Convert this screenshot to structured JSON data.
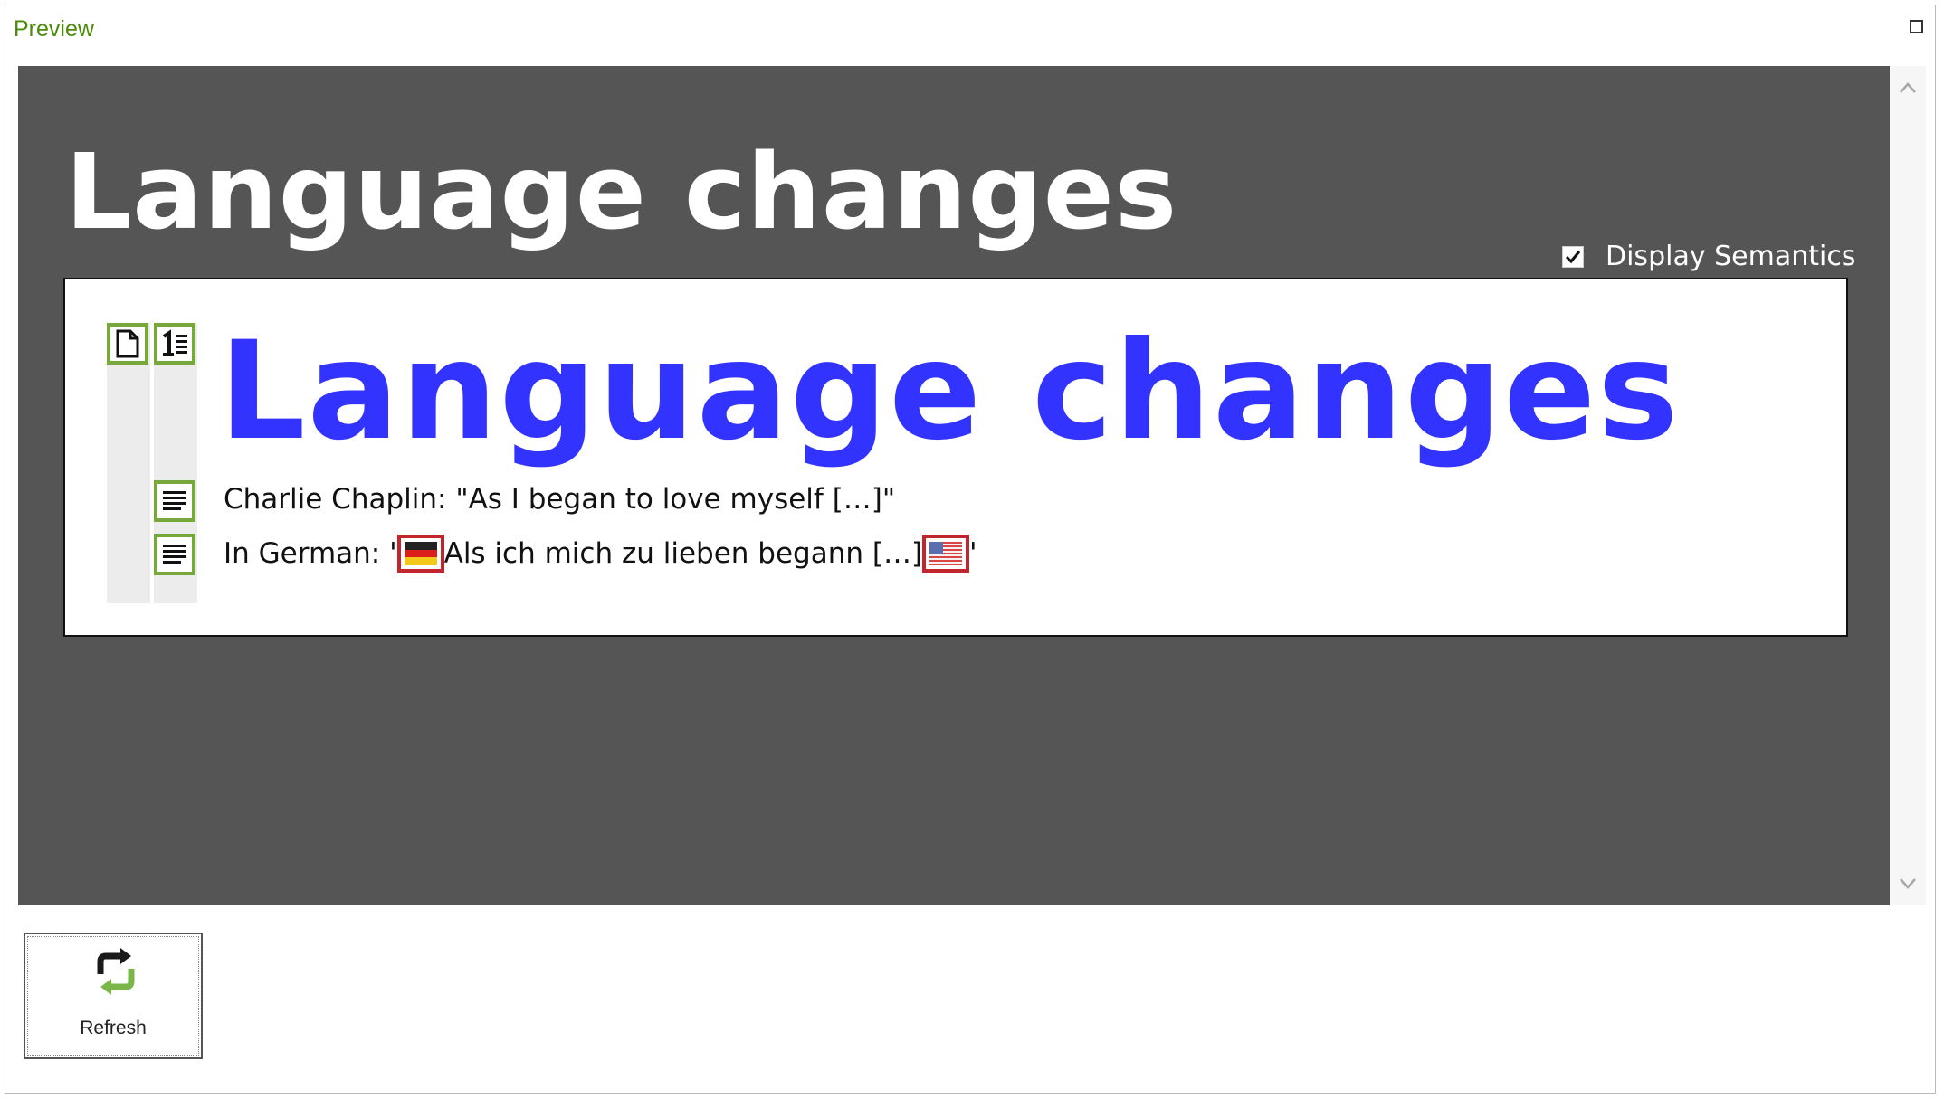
{
  "window": {
    "title": "Preview"
  },
  "preview": {
    "heading": "Language changes",
    "display_semantics": {
      "label": "Display Semantics",
      "checked": true
    }
  },
  "document": {
    "heading": "Language changes",
    "paragraph_1": "Charlie Chaplin: \"As I began to love myself […]\"",
    "paragraph_2": {
      "prefix": "In German: '",
      "german_text": "Als ich mich zu lieben begann […]",
      "suffix": "'"
    },
    "flags": {
      "start": "german-flag-icon",
      "end": "us-flag-icon"
    }
  },
  "toolbar": {
    "refresh_label": "Refresh"
  },
  "colors": {
    "accent_green": "#76a83a",
    "language_marker_red": "#c0262c",
    "heading_blue": "#3333ff",
    "viewport_bg": "#555555"
  }
}
